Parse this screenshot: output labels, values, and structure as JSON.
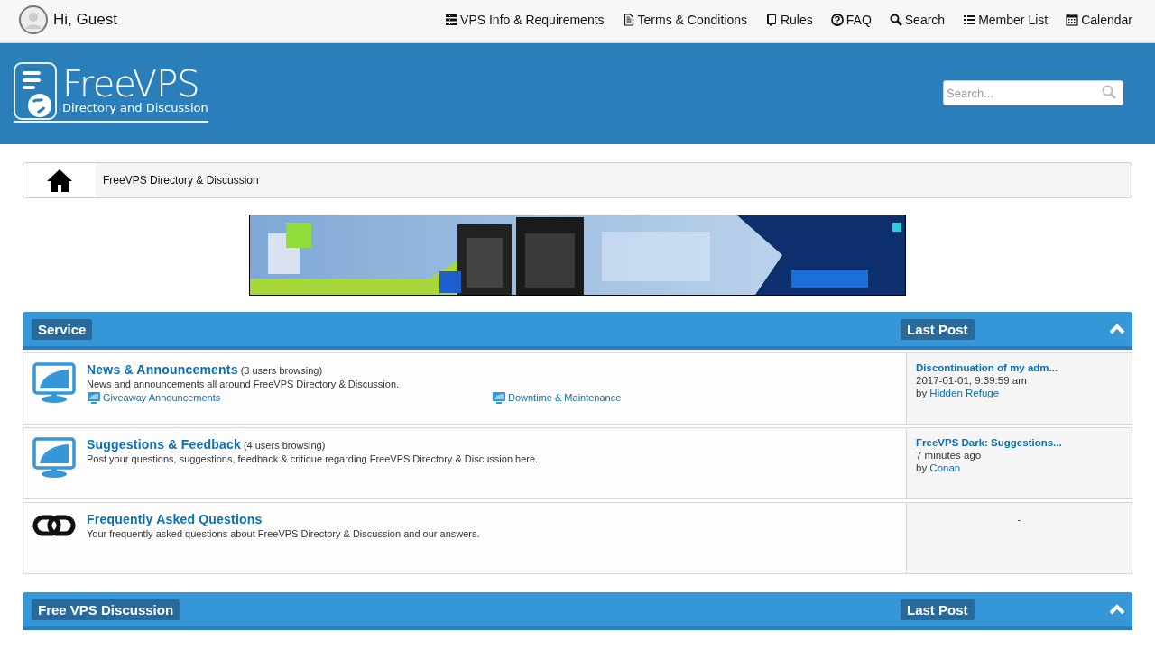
{
  "user": {
    "greeting": "Hi, Guest"
  },
  "nav": [
    {
      "label": "VPS Info & Requirements"
    },
    {
      "label": "Terms & Conditions"
    },
    {
      "label": "Rules"
    },
    {
      "label": "FAQ"
    },
    {
      "label": "Search"
    },
    {
      "label": "Member List"
    },
    {
      "label": "Calendar"
    }
  ],
  "logo": {
    "title": "FreeVPS",
    "subtitle": "Directory and Discussion"
  },
  "search": {
    "placeholder": "Search..."
  },
  "breadcrumb": [
    {
      "label": "FreeVPS Directory & Discussion"
    }
  ],
  "categories": [
    {
      "title": "Service",
      "last_post_header": "Last Post",
      "expanded": true,
      "forums": [
        {
          "kind": "forum",
          "title": "News & Announcements",
          "browsing": "(3 users browsing)",
          "description": "News and announcements all around FreeVPS Directory & Discussion.",
          "subforums": [
            {
              "label": "Giveaway Announcements"
            },
            {
              "label": "Downtime & Maintenance"
            }
          ],
          "last_post": {
            "kind": "post",
            "title": "Discontinuation of my adm...",
            "time": "2017-01-01, 9:39:59 am",
            "by": "by",
            "author": "Hidden Refuge"
          }
        },
        {
          "kind": "forum",
          "title": "Suggestions & Feedback",
          "browsing": "(4 users browsing)",
          "description": "Post your questions, suggestions, feedback & critique regarding FreeVPS Directory & Discussion here.",
          "last_post": {
            "kind": "post",
            "title": "FreeVPS Dark: Suggestions...",
            "time": "7 minutes ago",
            "by": "by",
            "author": "Conan"
          }
        },
        {
          "kind": "link",
          "title": "Frequently Asked Questions",
          "description": "Your frequently asked questions about FreeVPS Directory & Discussion and our answers.",
          "last_post": {
            "kind": "none",
            "text": "-"
          }
        }
      ]
    },
    {
      "title": "Free VPS Discussion",
      "last_post_header": "Last Post",
      "expanded": true
    }
  ]
}
